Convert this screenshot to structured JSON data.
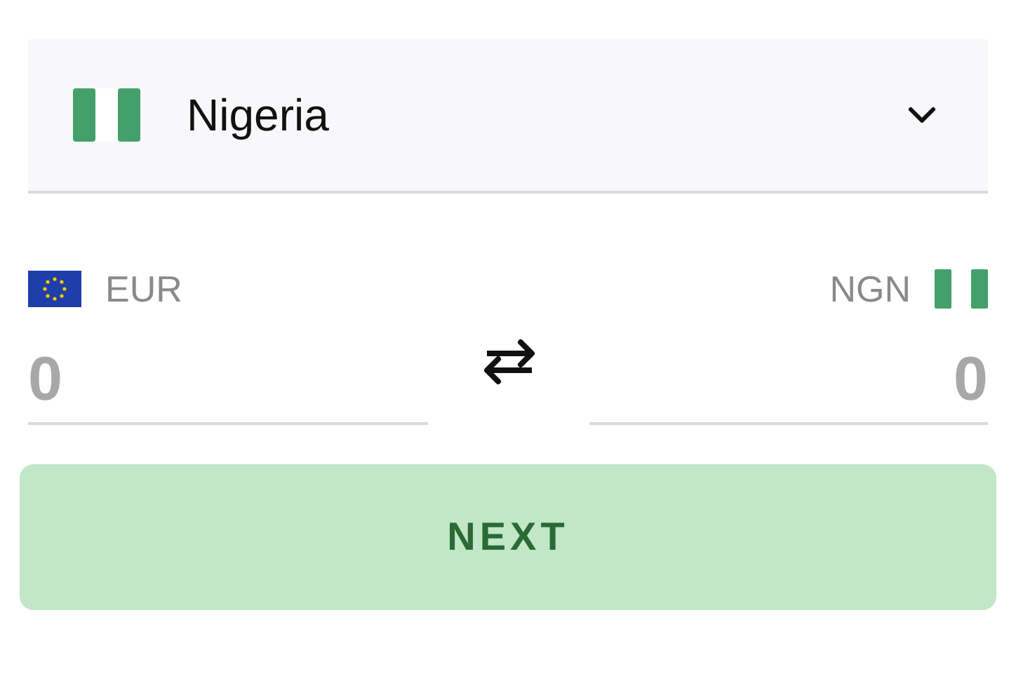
{
  "country_select": {
    "value": "Nigeria"
  },
  "converter": {
    "from": {
      "currency": "EUR",
      "placeholder": "0"
    },
    "to": {
      "currency": "NGN",
      "placeholder": "0"
    }
  },
  "next_button": {
    "label": "NEXT",
    "disabled": true
  }
}
